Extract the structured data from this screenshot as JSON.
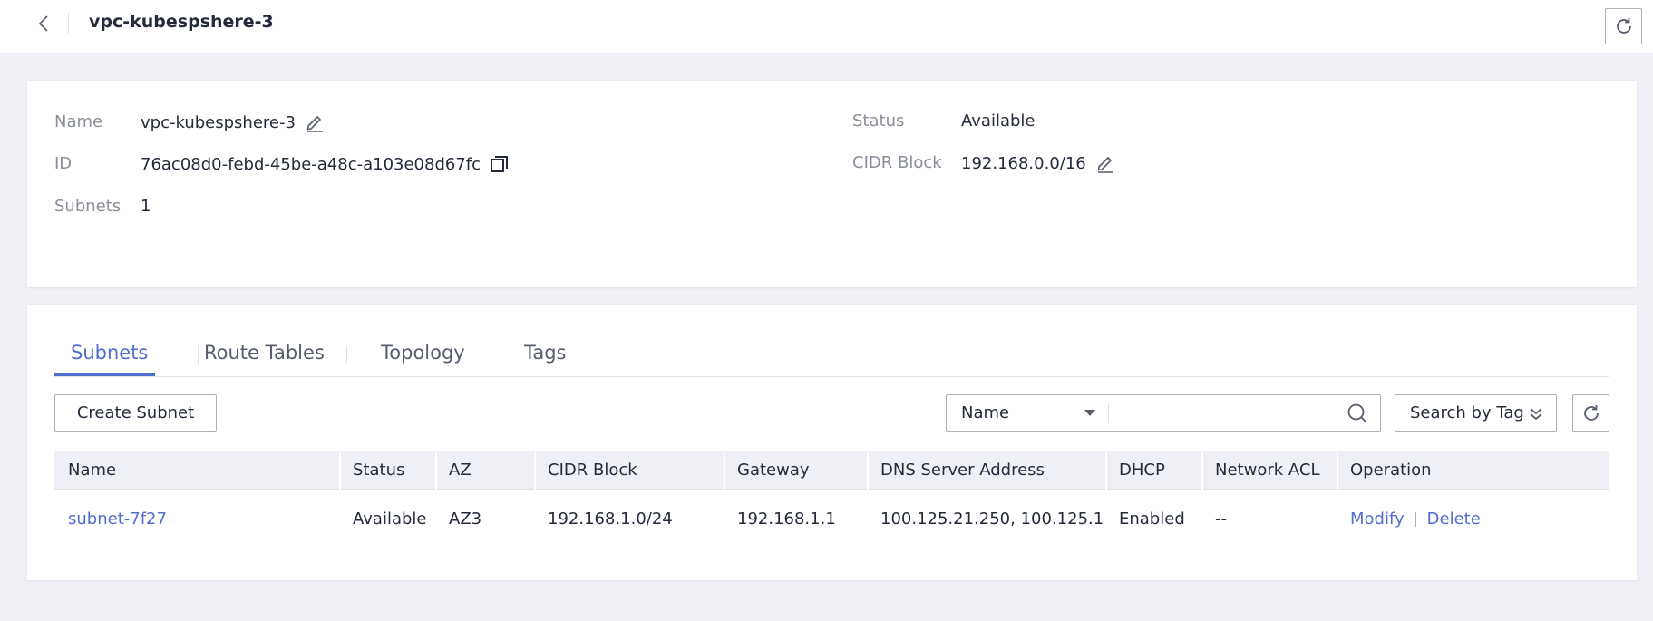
{
  "header": {
    "title": "vpc-kubespshere-3"
  },
  "info": {
    "name_label": "Name",
    "name_value": "vpc-kubespshere-3",
    "id_label": "ID",
    "id_value": "76ac08d0-febd-45be-a48c-a103e08d67fc",
    "subnets_label": "Subnets",
    "subnets_value": "1",
    "status_label": "Status",
    "status_value": "Available",
    "cidr_label": "CIDR Block",
    "cidr_value": "192.168.0.0/16"
  },
  "tabs": [
    {
      "label": "Subnets",
      "active": true
    },
    {
      "label": "Route Tables",
      "active": false
    },
    {
      "label": "Topology",
      "active": false
    },
    {
      "label": "Tags",
      "active": false
    }
  ],
  "toolbar": {
    "create_label": "Create Subnet",
    "search_field_selected": "Name",
    "search_value": "",
    "search_placeholder": "",
    "tag_search_label": "Search by Tag"
  },
  "table": {
    "columns": [
      "Name",
      "Status",
      "AZ",
      "CIDR Block",
      "Gateway",
      "DNS Server Address",
      "DHCP",
      "Network ACL",
      "Operation"
    ],
    "rows": [
      {
        "name": "subnet-7f27",
        "status": "Available",
        "az": "AZ3",
        "cidr": "192.168.1.0/24",
        "gateway": "192.168.1.1",
        "dns": "100.125.21.250, 100.125.1....",
        "dhcp": "Enabled",
        "acl": "--",
        "op_modify": "Modify",
        "op_delete": "Delete"
      }
    ]
  },
  "colors": {
    "accent": "#526ecc",
    "page_bg": "#eef0f5",
    "text": "#252b3a",
    "muted": "#8a8e99"
  }
}
